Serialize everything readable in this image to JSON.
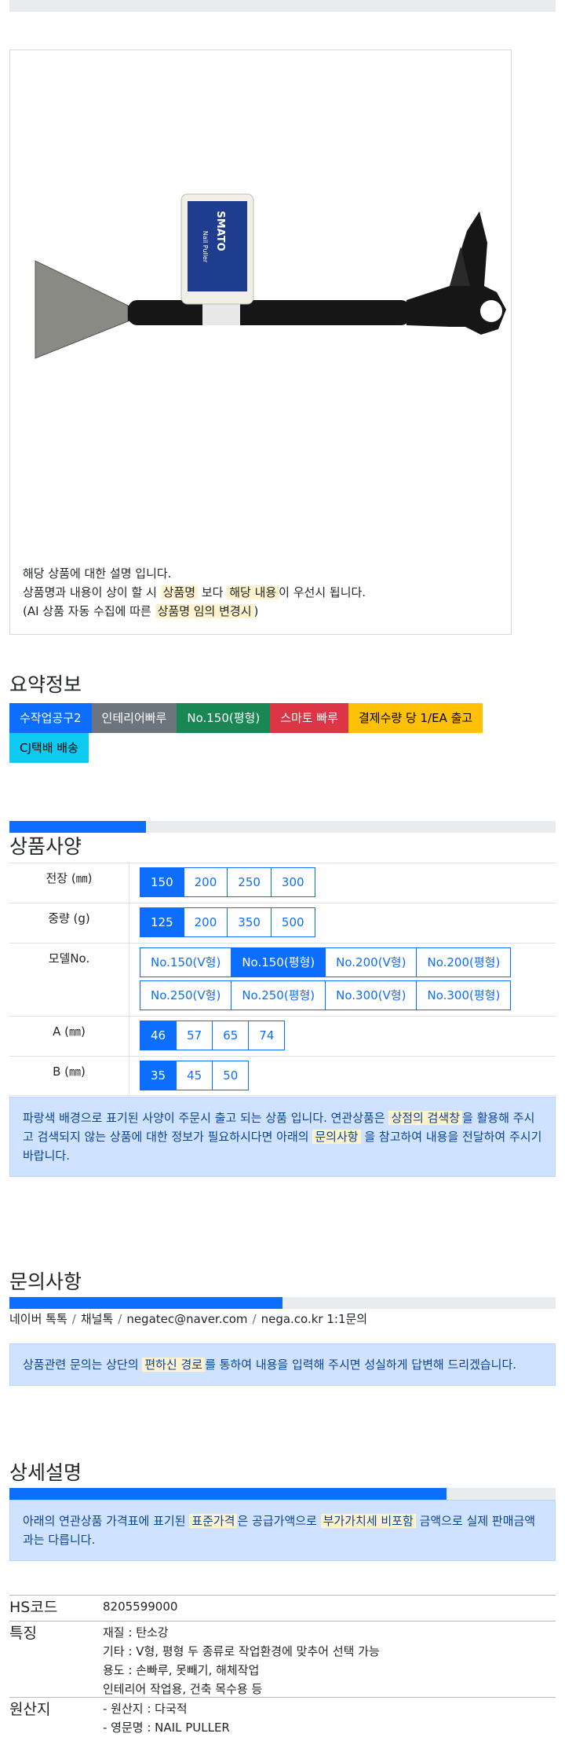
{
  "product": {
    "description_lines": [
      {
        "text": "해당 상품에 대한 설명 입니다."
      },
      {
        "pre": "상품명과 내용이 상이 할 시 ",
        "hl1": "상품명",
        "mid": " 보다 ",
        "hl2": "해당 내용",
        "post": "이 우선시 됩니다."
      },
      {
        "pre": "(AI 상품 자동 수집에 따른 ",
        "hl1": "상품명 임의 변경시",
        "post": ")"
      }
    ],
    "tag_text": "SMATO",
    "tag_sub": "Nail Puller"
  },
  "summary": {
    "title": "요약정보",
    "badges": [
      {
        "label": "수작업공구2",
        "color": "blue"
      },
      {
        "label": "인테리어빠루",
        "color": "gray"
      },
      {
        "label": "No.150(평형)",
        "color": "green"
      },
      {
        "label": "스마토 빠루",
        "color": "red"
      },
      {
        "label": "결제수량 당 1/EA 출고",
        "color": "yellow"
      },
      {
        "label": "CJ택배 배송",
        "color": "cyan"
      }
    ]
  },
  "specs": {
    "title": "상품사양",
    "progress": 0.25,
    "rows": [
      {
        "label": "전장 (㎜)",
        "options": [
          "150",
          "200",
          "250",
          "300"
        ],
        "active": 0
      },
      {
        "label": "중량 (g)",
        "options": [
          "125",
          "200",
          "350",
          "500"
        ],
        "active": 0
      },
      {
        "label": "모델No.",
        "options": [
          "No.150(V형)",
          "No.150(평형)",
          "No.200(V형)",
          "No.200(평형)",
          "No.250(V형)",
          "No.250(평형)",
          "No.300(V형)",
          "No.300(평형)"
        ],
        "active": 1
      },
      {
        "label": "A (㎜)",
        "options": [
          "46",
          "57",
          "65",
          "74"
        ],
        "active": 0
      },
      {
        "label": "B (㎜)",
        "options": [
          "35",
          "45",
          "50"
        ],
        "active": 0
      }
    ],
    "alert": {
      "pre": "파랑색 배경으로 표기된 사양이 주문시 출고 되는 상품 입니다. 연관상품은 ",
      "hl1": "상점의 검색창",
      "mid": "을 활용해 주시고 검색되지 않는 상품에 대한 정보가 필요하시다면 아래의 ",
      "hl2": "문의사항",
      "post": " 을 참고하여 내용을 전달하여 주시기 바랍니다."
    }
  },
  "inquiry": {
    "title": "문의사항",
    "progress": 0.5,
    "links": [
      "네이버 톡톡",
      "채널톡",
      "negatec@naver.com",
      "nega.co.kr 1:1문의"
    ],
    "alert": {
      "pre": "상품관련 문의는 상단의 ",
      "hl1": "편하신 경로",
      "post": "를 통하여 내용을 입력해 주시면 성실하게 답변해 드리겠습니다."
    }
  },
  "detail": {
    "title": "상세설명",
    "progress": 0.8,
    "alert": {
      "pre": "아래의 연관상품 가격표에 표기된 ",
      "hl1": "표준가격",
      "mid": "은 공급가액으로 ",
      "hl2": "부가가치세 비포함",
      "post": " 금액으로 실제 판매금액과는 다릅니다."
    },
    "rows": [
      {
        "key": "HS코드",
        "values": [
          "8205599000"
        ]
      },
      {
        "key": "특징",
        "values": [
          "재질 : 탄소강",
          "기타 : V형, 평형 두 종류로 작업환경에 맞추어 선택 가능",
          "용도 : 손빠루, 못빼기, 해체작업",
          "인테리어 작업용, 건축 목수용 등"
        ]
      },
      {
        "key": "원산지",
        "values": [
          "- 원산지 : 다국적",
          "- 영문명 : NAIL PULLER"
        ]
      }
    ]
  }
}
